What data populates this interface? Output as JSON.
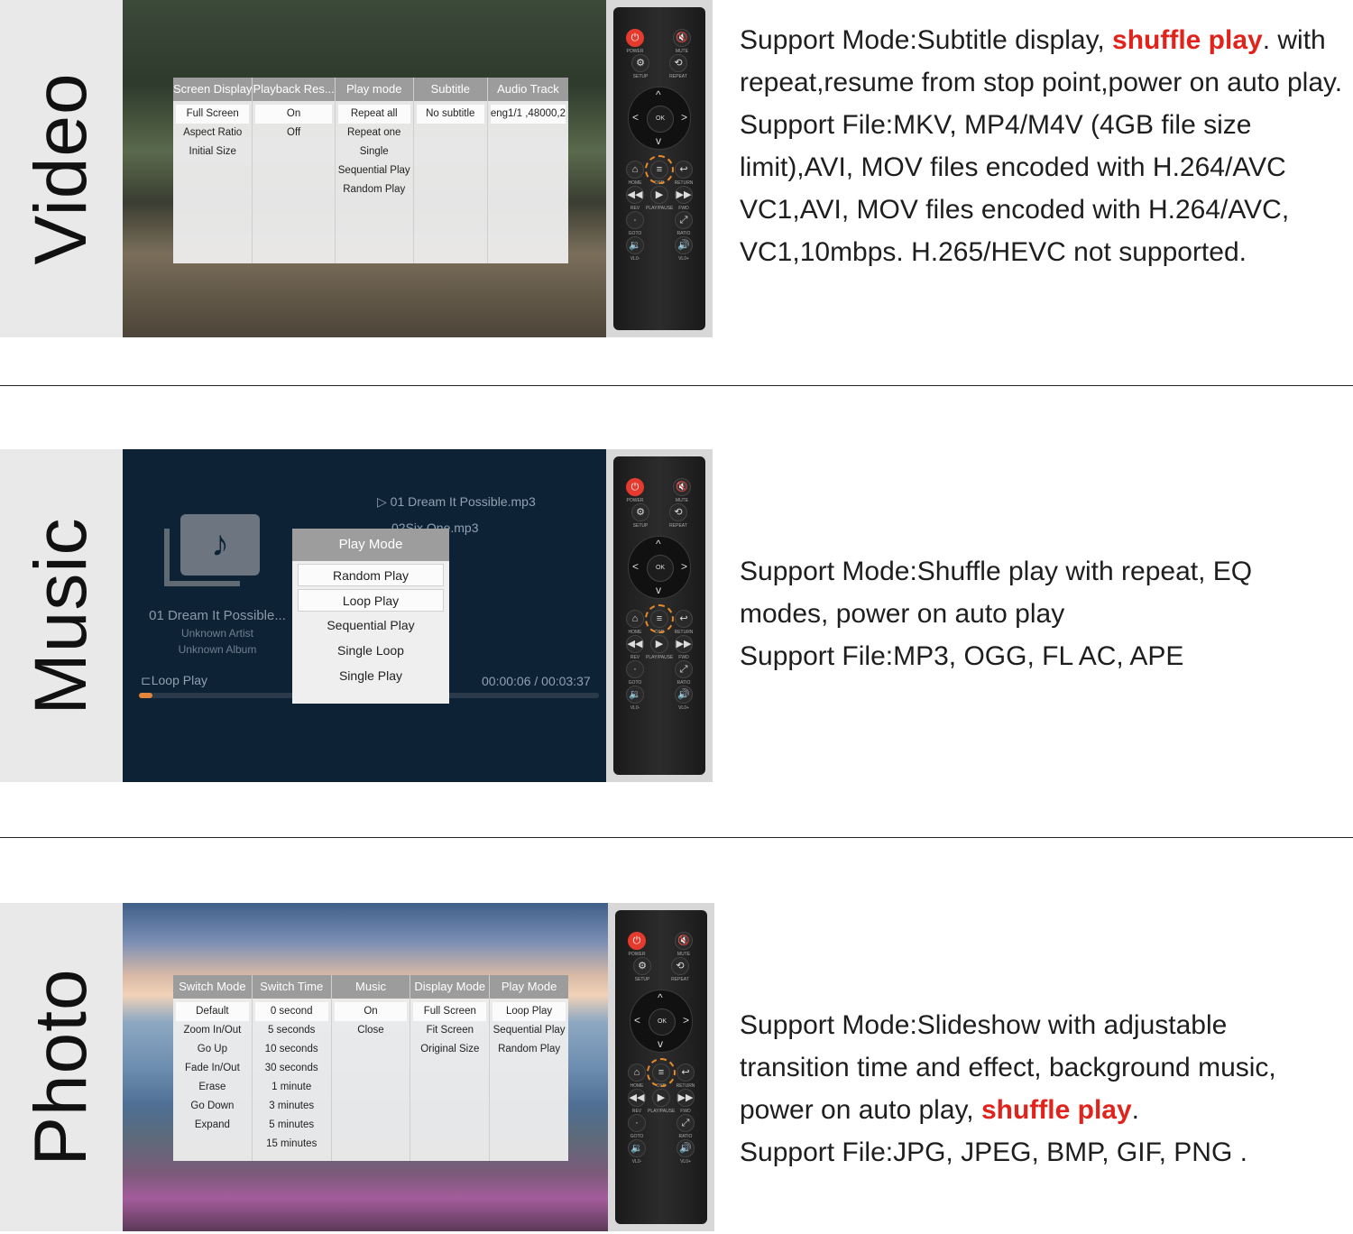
{
  "video": {
    "label": "Video",
    "menu": [
      {
        "head": "Screen Display",
        "items": [
          "Full Screen",
          "Aspect Ratio",
          "Initial Size"
        ],
        "selected": 0
      },
      {
        "head": "Playback Res...",
        "items": [
          "On",
          "Off"
        ],
        "selected": 0
      },
      {
        "head": "Play mode",
        "items": [
          "Repeat all",
          "Repeat one",
          "Single",
          "Sequential Play",
          "Random Play"
        ],
        "selected": 0
      },
      {
        "head": "Subtitle",
        "items": [
          "No subtitle"
        ],
        "selected": 0
      },
      {
        "head": "Audio Track",
        "items": [
          "eng1/1 ,48000,2"
        ],
        "selected": 0
      }
    ],
    "desc_pre": "Support Mode:Subtitle display, ",
    "desc_hl": "shuffle play",
    "desc_post": ". with repeat,resume from stop point,power on auto play.",
    "desc_files": "Support File:MKV, MP4/M4V (4GB file size limit),AVI, MOV files encoded with H.264/AVC VC1,AVI, MOV files encoded with H.264/AVC, VC1,10mbps. H.265/HEVC not supported."
  },
  "music": {
    "label": "Music",
    "track1": "01 Dream It Possible.mp3",
    "track2": "02Six One.mp3",
    "now_title": "01 Dream It Possible...",
    "artist": "Unknown Artist",
    "album": "Unknown Album",
    "loop_label": "Loop Play",
    "time": "00:00:06 / 00:03:37",
    "progress_fraction": 0.03,
    "playmode_title": "Play Mode",
    "playmode_items": [
      "Random Play",
      "Loop Play",
      "Sequential Play",
      "Single Loop",
      "Single Play"
    ],
    "desc": "Support Mode:Shuffle play with repeat, EQ modes, power on auto play",
    "desc_files": "Support File:MP3, OGG, FL AC, APE"
  },
  "photo": {
    "label": "Photo",
    "menu": [
      {
        "head": "Switch Mode",
        "items": [
          "Default",
          "Zoom In/Out",
          "Go Up",
          "Fade In/Out",
          "Erase",
          "Go Down",
          "Expand"
        ],
        "selected": 0
      },
      {
        "head": "Switch Time",
        "items": [
          "0 second",
          "5 seconds",
          "10 seconds",
          "30 seconds",
          "1 minute",
          "3 minutes",
          "5 minutes",
          "15 minutes"
        ],
        "selected": 0
      },
      {
        "head": "Music",
        "items": [
          "On",
          "Close"
        ],
        "selected": 0
      },
      {
        "head": "Display Mode",
        "items": [
          "Full Screen",
          "Fit Screen",
          "Original Size"
        ],
        "selected": 0
      },
      {
        "head": "Play Mode",
        "items": [
          "Loop Play",
          "Sequential Play",
          "Random Play"
        ],
        "selected": 0
      }
    ],
    "desc_pre": "Support Mode:Slideshow with adjustable transition time and effect, background music, power on auto play, ",
    "desc_hl": "shuffle play",
    "desc_post": ".",
    "desc_files": "Support File:JPG, JPEG, BMP, GIF, PNG ."
  },
  "remote": {
    "power": "POWER",
    "mute": "MUTE",
    "setup": "SETUP",
    "repeat": "REPEAT",
    "ok": "OK",
    "home": "HOME",
    "osd": "OSD",
    "return": "RETURN",
    "rev": "REV",
    "playpause": "PLAY/PAUSE",
    "fwd": "FWD",
    "goto": "GOTO",
    "ratio": "RATIO",
    "vol_minus": "VL0-",
    "vol_plus": "VL0+"
  },
  "colors": {
    "highlight": "#e0241c",
    "osd_ring": "#e88a2a",
    "power": "#e53b2f"
  }
}
